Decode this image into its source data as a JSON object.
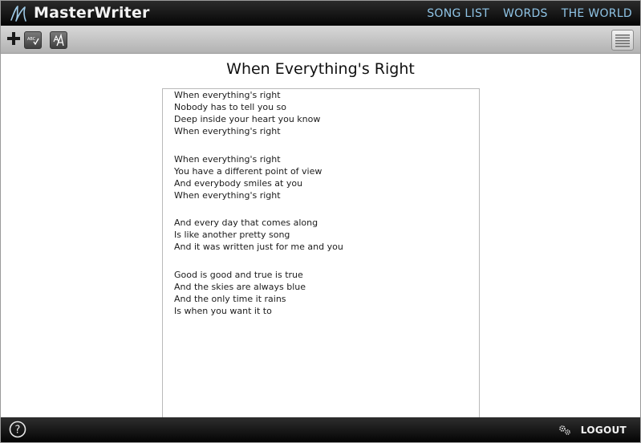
{
  "app": {
    "brand": "MasterWriter"
  },
  "nav": {
    "items": [
      {
        "label": "SONG LIST"
      },
      {
        "label": "WORDS"
      },
      {
        "label": "THE WORLD"
      }
    ]
  },
  "toolbar": {
    "spellcheck_icon_text": "ABC",
    "icons": [
      "plus-icon",
      "spellcheck-icon",
      "font-style-icon",
      "menu-lines-icon"
    ]
  },
  "song": {
    "title": "When Everything's Right",
    "verses": [
      [
        "When everything's right",
        "Nobody has to tell you so",
        "Deep inside your heart you know",
        "When everything's right"
      ],
      [
        "When everything's right",
        "You have a different point of view",
        "And everybody smiles at you",
        "When everything's right"
      ],
      [
        "And every day that comes along",
        "Is like another pretty song",
        "And it was written just for me and you"
      ],
      [
        "Good is good and true is true",
        "And the skies are always blue",
        "And the only time it rains",
        "Is when you want it to"
      ]
    ]
  },
  "bottombar": {
    "help_label": "?",
    "logout_label": "LOGOUT",
    "icons": [
      "help-icon",
      "gears-icon"
    ]
  },
  "colors": {
    "nav_link": "#8fc4e6",
    "bar_dark": "#050505",
    "toolbar_gray": "#c4c4c4"
  }
}
